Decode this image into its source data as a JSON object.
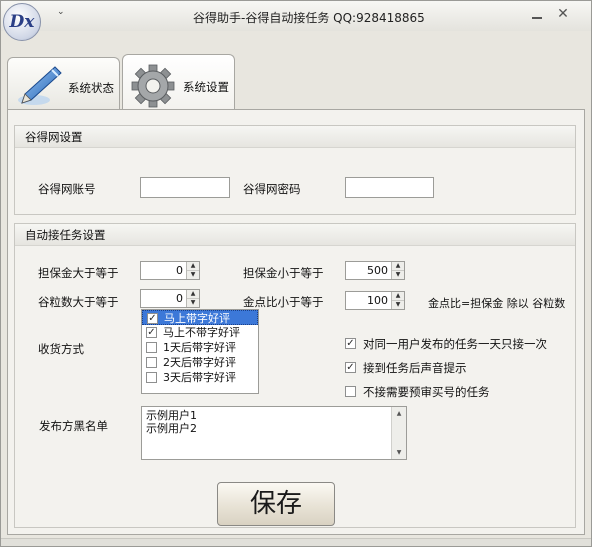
{
  "window": {
    "title": "谷得助手-谷得自动接任务 QQ:928418865",
    "logo_text": "Dx",
    "menu_glyph": "⌄",
    "minimize_glyph": "",
    "close_glyph": "✕"
  },
  "tabs": [
    {
      "label": "系统状态",
      "icon": "pen-icon",
      "active": false
    },
    {
      "label": "系统设置",
      "icon": "gear-icon",
      "active": true
    }
  ],
  "guder_settings": {
    "title": "谷得网设置",
    "account_label": "谷得网账号",
    "account_value": "",
    "password_label": "谷得网密码",
    "password_value": ""
  },
  "auto_task": {
    "title": "自动接任务设置",
    "deposit_min_label": "担保金大于等于",
    "deposit_min_value": "0",
    "deposit_max_label": "担保金小于等于",
    "deposit_max_value": "500",
    "grain_min_label": "谷粒数大于等于",
    "grain_min_value": "0",
    "ratio_max_label": "金点比小于等于",
    "ratio_max_value": "100",
    "ratio_note": "金点比=担保金 除以 谷粒数",
    "receive_label": "收货方式",
    "receive_options": [
      {
        "label": "马上带字好评",
        "checked": true,
        "selected": true
      },
      {
        "label": "马上不带字好评",
        "checked": true,
        "selected": false
      },
      {
        "label": "1天后带字好评",
        "checked": false,
        "selected": false
      },
      {
        "label": "2天后带字好评",
        "checked": false,
        "selected": false
      },
      {
        "label": "3天后带字好评",
        "checked": false,
        "selected": false
      }
    ],
    "options": [
      {
        "label": "对同一用户发布的任务一天只接一次",
        "checked": true
      },
      {
        "label": "接到任务后声音提示",
        "checked": true
      },
      {
        "label": "不接需要预审买号的任务",
        "checked": false
      }
    ],
    "blacklist_label": "发布方黑名单",
    "blacklist_lines": [
      "示例用户1",
      "示例用户2"
    ],
    "save_label": "保存"
  }
}
